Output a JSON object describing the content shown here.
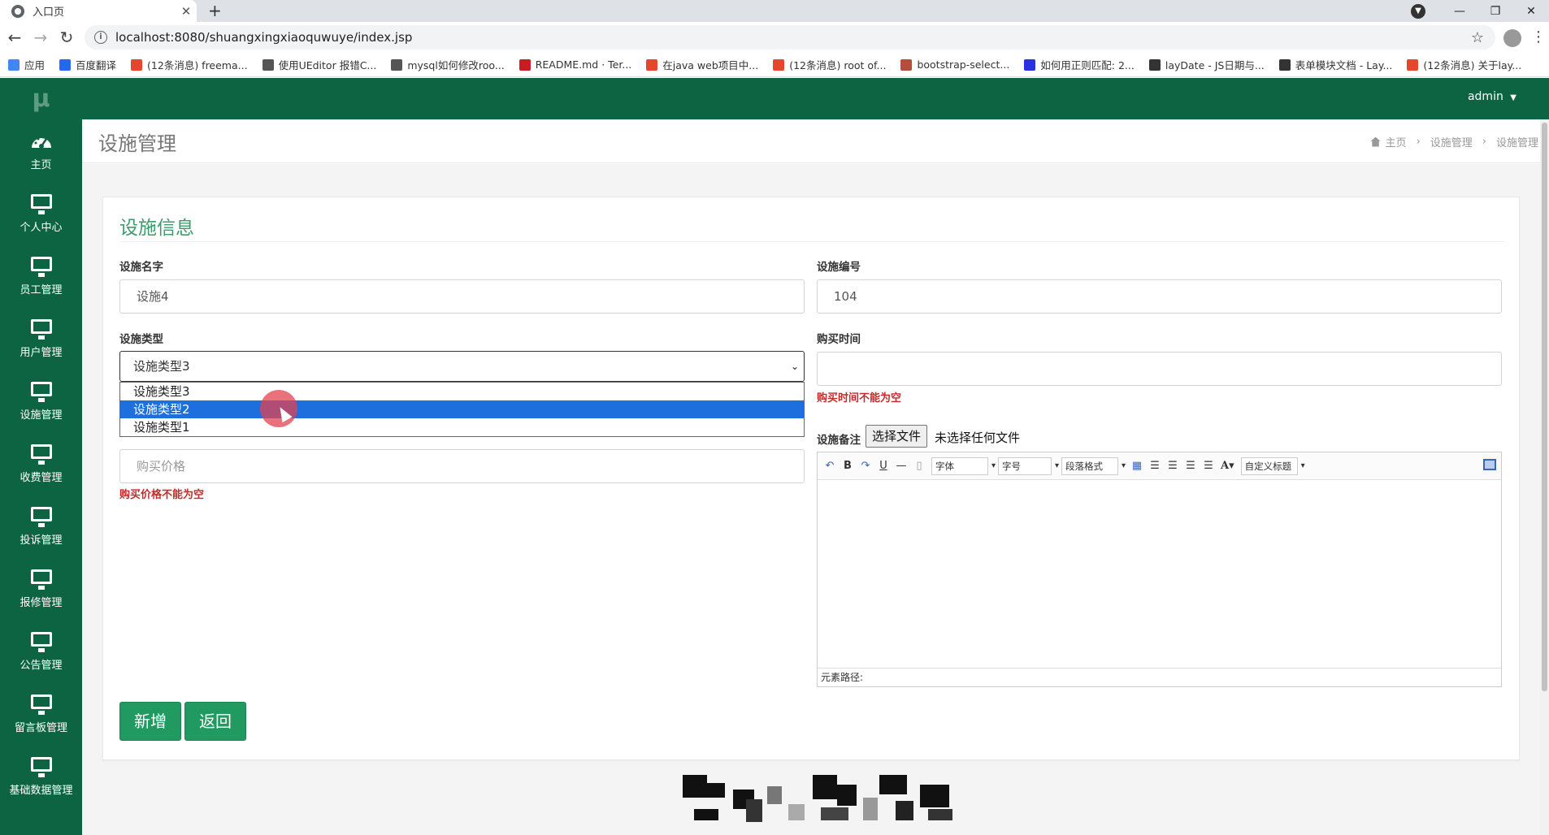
{
  "browser": {
    "tab_title": "入口页",
    "url": "localhost:8080/shuangxingxiaoquwuye/index.jsp",
    "bookmarks": [
      {
        "label": "应用",
        "color": "#4285f4"
      },
      {
        "label": "百度翻译",
        "color": "#2468f2"
      },
      {
        "label": "(12条消息) freema...",
        "color": "#e5472d"
      },
      {
        "label": "使用UEditor 报错C...",
        "color": "#555555"
      },
      {
        "label": "mysql如何修改roo...",
        "color": "#555555"
      },
      {
        "label": "README.md · Ter...",
        "color": "#c71d23"
      },
      {
        "label": "在java web项目中...",
        "color": "#e5472d"
      },
      {
        "label": "(12条消息) root of...",
        "color": "#e5472d"
      },
      {
        "label": "bootstrap-select...",
        "color": "#b44d3c"
      },
      {
        "label": "如何用正则匹配: 2...",
        "color": "#2932e1"
      },
      {
        "label": "layDate - JS日期与...",
        "color": "#333333"
      },
      {
        "label": "表单模块文档 - Lay...",
        "color": "#333333"
      },
      {
        "label": "(12条消息) 关于lay...",
        "color": "#e5472d"
      }
    ]
  },
  "app": {
    "logo": "μ",
    "user": "admin",
    "sidebar": [
      {
        "label": "主页",
        "icon": "dashboard-icon"
      },
      {
        "label": "个人中心",
        "icon": "monitor-icon"
      },
      {
        "label": "员工管理",
        "icon": "monitor-icon"
      },
      {
        "label": "用户管理",
        "icon": "monitor-icon"
      },
      {
        "label": "设施管理",
        "icon": "monitor-icon"
      },
      {
        "label": "收费管理",
        "icon": "monitor-icon"
      },
      {
        "label": "投诉管理",
        "icon": "monitor-icon"
      },
      {
        "label": "报修管理",
        "icon": "monitor-icon"
      },
      {
        "label": "公告管理",
        "icon": "monitor-icon"
      },
      {
        "label": "留言板管理",
        "icon": "monitor-icon"
      },
      {
        "label": "基础数据管理",
        "icon": "monitor-icon"
      }
    ]
  },
  "page": {
    "title": "设施管理",
    "breadcrumb": [
      "主页",
      "设施管理",
      "设施管理"
    ],
    "card_title": "设施信息"
  },
  "form": {
    "name_label": "设施名字",
    "name_value": "设施4",
    "number_label": "设施编号",
    "number_value": "104",
    "type_label": "设施类型",
    "type_value": "设施类型3",
    "type_options": [
      "设施类型3",
      "设施类型2",
      "设施类型1"
    ],
    "type_highlighted": "设施类型2",
    "buy_time_label": "购买时间",
    "buy_time_value": "",
    "buy_time_error": "购买时间不能为空",
    "price_placeholder": "购买价格",
    "price_error": "购买价格不能为空",
    "remark_label": "设施备注",
    "file_button": "选择文件",
    "file_status": "未选择任何文件",
    "editor": {
      "font_label": "字体",
      "size_label": "字号",
      "para_label": "段落格式",
      "custom_title_label": "自定义标题",
      "footer": "元素路径:"
    },
    "add_button": "新增",
    "back_button": "返回"
  },
  "colors": {
    "brand_green": "#0c6443",
    "accent_green": "#219a61",
    "error_red": "#c52a2a",
    "select_blue": "#1e6fde"
  }
}
